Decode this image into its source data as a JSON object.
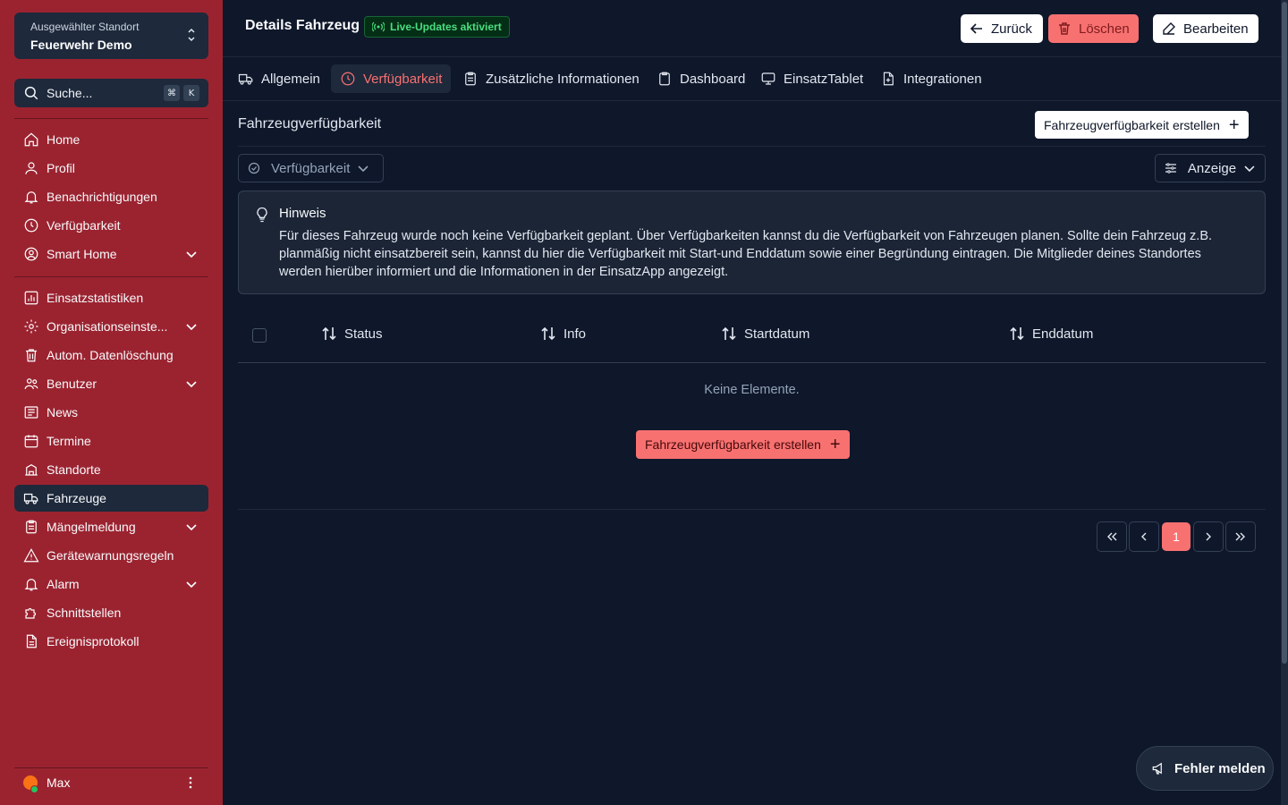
{
  "sidebar": {
    "location_label": "Ausgewählter Standort",
    "location_value": "Feuerwehr Demo",
    "search_placeholder": "Suche...",
    "search_shortcut_1": "⌘",
    "search_shortcut_2": "K",
    "items": [
      {
        "label": "Home",
        "icon": "home-icon"
      },
      {
        "label": "Profil",
        "icon": "user-icon"
      },
      {
        "label": "Benachrichtigungen",
        "icon": "bell-icon"
      },
      {
        "label": "Verfügbarkeit",
        "icon": "clock-icon"
      },
      {
        "label": "Smart Home",
        "icon": "user-circle-icon",
        "expandable": true
      },
      {
        "label": "Einsatzstatistiken",
        "icon": "chart-icon"
      },
      {
        "label": "Organisationseinste...",
        "icon": "gear-icon",
        "expandable": true
      },
      {
        "label": "Autom. Datenlöschung",
        "icon": "trash-icon"
      },
      {
        "label": "Benutzer",
        "icon": "users-icon",
        "expandable": true
      },
      {
        "label": "News",
        "icon": "newspaper-icon"
      },
      {
        "label": "Termine",
        "icon": "calendar-icon"
      },
      {
        "label": "Standorte",
        "icon": "building-icon"
      },
      {
        "label": "Fahrzeuge",
        "icon": "truck-icon",
        "active": true
      },
      {
        "label": "Mängelmeldung",
        "icon": "clipboard-icon",
        "expandable": true
      },
      {
        "label": "Gerätewarnungsregeln",
        "icon": "warning-icon"
      },
      {
        "label": "Alarm",
        "icon": "bell-icon",
        "expandable": true
      },
      {
        "label": "Schnittstellen",
        "icon": "puzzle-icon"
      },
      {
        "label": "Ereignisprotokoll",
        "icon": "file-icon"
      }
    ],
    "user_name": "Max"
  },
  "header": {
    "title": "Details Fahrzeug",
    "live_badge": "Live-Updates aktiviert",
    "back_label": "Zurück",
    "delete_label": "Löschen",
    "edit_label": "Bearbeiten"
  },
  "tabs": [
    {
      "label": "Allgemein",
      "icon": "truck-icon"
    },
    {
      "label": "Verfügbarkeit",
      "icon": "clock-icon",
      "active": true
    },
    {
      "label": "Zusätzliche Informationen",
      "icon": "clipboard-icon"
    },
    {
      "label": "Dashboard",
      "icon": "clipboard-icon"
    },
    {
      "label": "EinsatzTablet",
      "icon": "monitor-icon"
    },
    {
      "label": "Integrationen",
      "icon": "file-plus-icon"
    }
  ],
  "section": {
    "title": "Fahrzeugverfügbarkeit",
    "create_label": "Fahrzeugverfügbarkeit erstellen",
    "filter_label": "Verfügbarkeit",
    "view_label": "Anzeige"
  },
  "hint": {
    "title": "Hinweis",
    "body": "Für dieses Fahrzeug wurde noch keine Verfügbarkeit geplant. Über Verfügbarkeiten kannst du die Verfügbarkeit von Fahrzeugen planen. Sollte dein Fahrzeug z.B. planmäßig nicht einsatzbereit sein, kannst du hier die Verfügbarkeit mit Start-und Enddatum sowie einer Begründung eintragen. Die Mitglieder deines Standortes werden hierüber informiert und die Informationen in der EinsatzApp angezeigt."
  },
  "table": {
    "columns": [
      "Status",
      "Info",
      "Startdatum",
      "Enddatum"
    ],
    "empty_text": "Keine Elemente.",
    "create_label": "Fahrzeugverfügbarkeit erstellen",
    "current_page": "1"
  },
  "report_label": "Fehler melden",
  "colors": {
    "sidebar": "#9b2330",
    "accent": "#f87171",
    "background": "#0f172a",
    "live": "#4ade80"
  }
}
